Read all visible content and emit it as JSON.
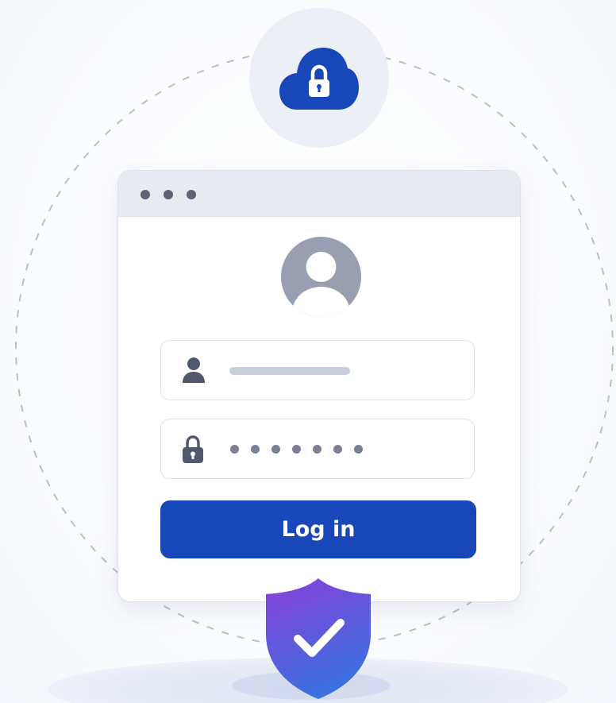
{
  "header": {
    "cloud_icon": "cloud-lock-icon"
  },
  "window": {
    "controls": [
      "window-dot",
      "window-dot",
      "window-dot"
    ],
    "avatar_icon": "user-avatar-icon"
  },
  "form": {
    "username": {
      "icon": "user-icon",
      "value": ""
    },
    "password": {
      "icon": "lock-icon",
      "masked_length": 7
    },
    "login_label": "Log in"
  },
  "badge": {
    "icon": "shield-check-icon"
  },
  "colors": {
    "primary": "#1747b8",
    "window_bar": "#e9ebf3",
    "shield_top": "#8a3fd8",
    "shield_bottom": "#3c6fe0",
    "avatar": "#999eb1"
  }
}
